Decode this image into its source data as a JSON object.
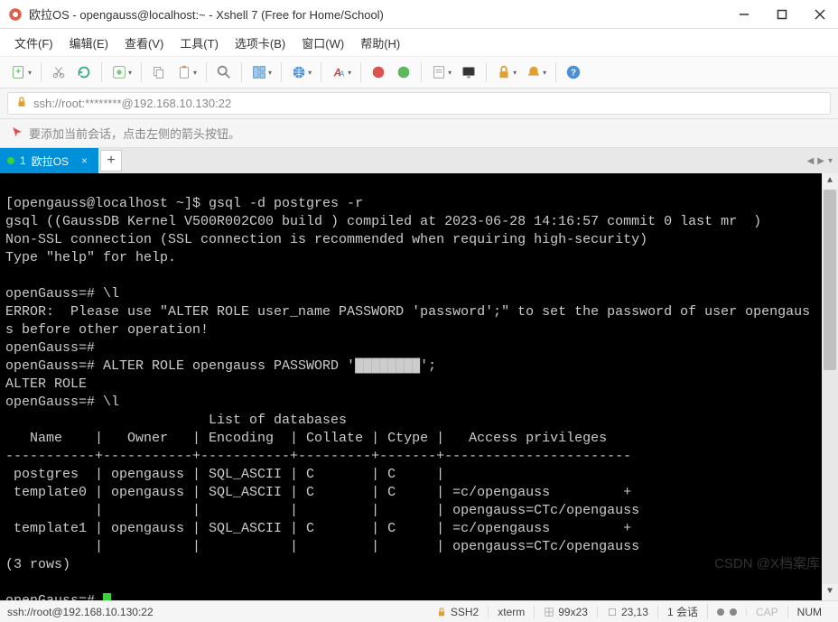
{
  "window": {
    "title": "欧拉OS - opengauss@localhost:~ - Xshell 7 (Free for Home/School)"
  },
  "menu": {
    "file": "文件(F)",
    "edit": "编辑(E)",
    "view": "查看(V)",
    "tools": "工具(T)",
    "tabs": "选项卡(B)",
    "window": "窗口(W)",
    "help": "帮助(H)"
  },
  "address": {
    "text": "ssh://root:********@192.168.10.130:22"
  },
  "hint": {
    "text": "要添加当前会话，点击左侧的箭头按钮。"
  },
  "tab": {
    "index": "1",
    "label": "欧拉OS"
  },
  "terminal_lines": [
    "[opengauss@localhost ~]$ gsql -d postgres -r",
    "gsql ((GaussDB Kernel V500R002C00 build ) compiled at 2023-06-28 14:16:57 commit 0 last mr  )",
    "Non-SSL connection (SSL connection is recommended when requiring high-security)",
    "Type \"help\" for help.",
    "",
    "openGauss=# \\l",
    "ERROR:  Please use \"ALTER ROLE user_name PASSWORD 'password';\" to set the password of user opengaus",
    "s before other operation!",
    "openGauss=#",
    "openGauss=# ALTER ROLE opengauss PASSWORD '████████';",
    "ALTER ROLE",
    "openGauss=# \\l",
    "                         List of databases",
    "   Name    |   Owner   | Encoding  | Collate | Ctype |   Access privileges   ",
    "-----------+-----------+-----------+---------+-------+-----------------------",
    " postgres  | opengauss | SQL_ASCII | C       | C     | ",
    " template0 | opengauss | SQL_ASCII | C       | C     | =c/opengauss         +",
    "           |           |           |         |       | opengauss=CTc/opengauss",
    " template1 | opengauss | SQL_ASCII | C       | C     | =c/opengauss         +",
    "           |           |           |         |       | opengauss=CTc/opengauss",
    "(3 rows)",
    "",
    "openGauss=# "
  ],
  "watermark": "CSDN @X档案库",
  "status": {
    "conn": "ssh://root@192.168.10.130:22",
    "proto": "SSH2",
    "term": "xterm",
    "size": "99x23",
    "pos": "23,13",
    "sessions": "1 会话",
    "cap": "CAP",
    "num": "NUM"
  }
}
